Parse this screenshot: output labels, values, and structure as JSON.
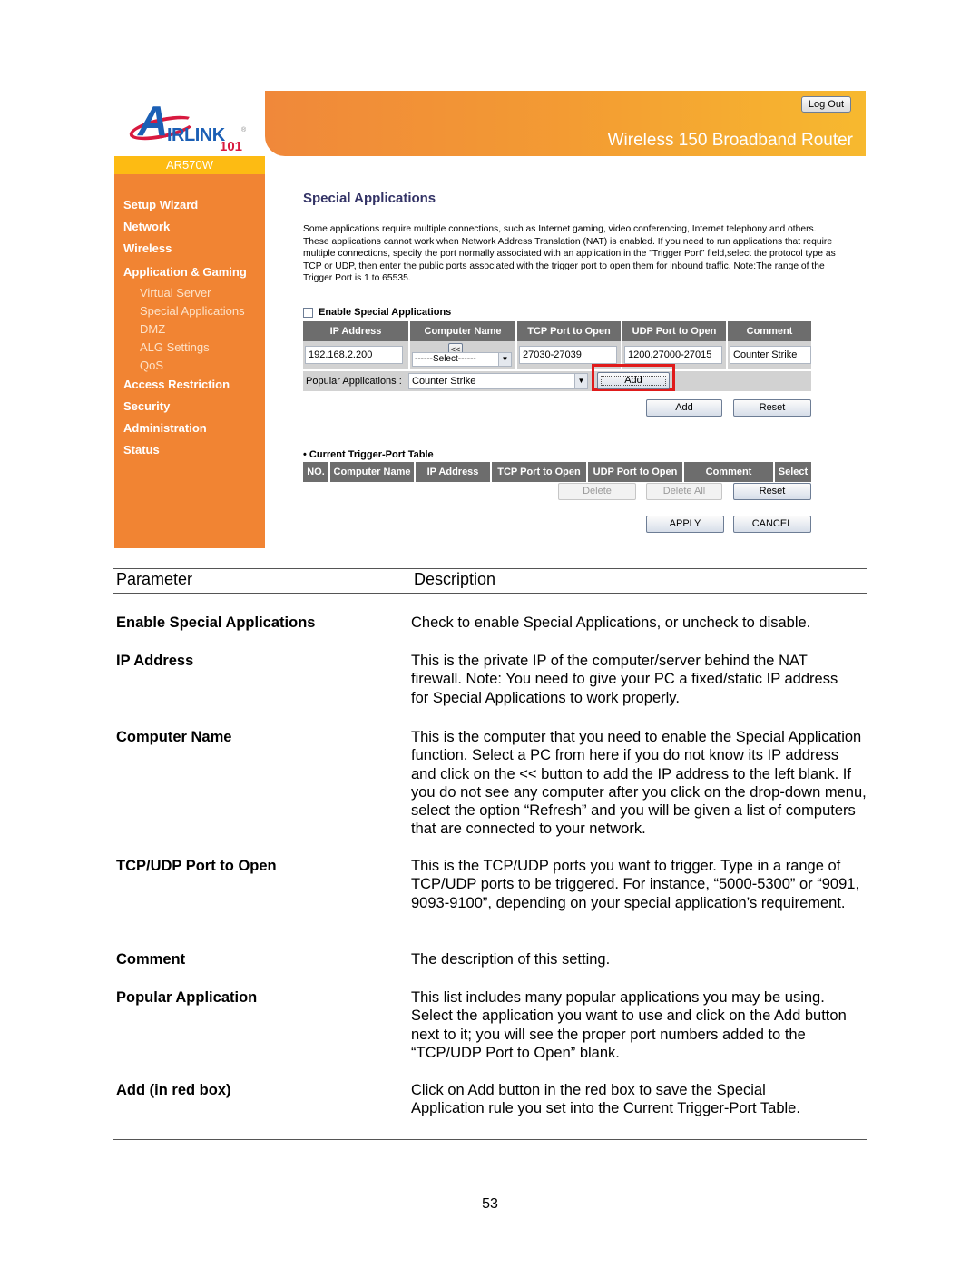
{
  "router_ui": {
    "logo": {
      "brand": "IRLINK",
      "initial": "A",
      "suffix": "101",
      "registered": "®"
    },
    "model": "AR570W",
    "banner_title": "Wireless 150 Broadband Router",
    "logout_label": "Log Out",
    "sidebar": {
      "items": [
        {
          "label": "Setup Wizard",
          "level": "main"
        },
        {
          "label": "Network",
          "level": "main"
        },
        {
          "label": "Wireless",
          "level": "main"
        },
        {
          "label": "Application & Gaming",
          "level": "main"
        },
        {
          "label": "Virtual Server",
          "level": "sub"
        },
        {
          "label": "Special Applications",
          "level": "sub"
        },
        {
          "label": "DMZ",
          "level": "sub"
        },
        {
          "label": "ALG Settings",
          "level": "sub"
        },
        {
          "label": "QoS",
          "level": "sub"
        },
        {
          "label": "Access Restriction",
          "level": "main"
        },
        {
          "label": "Security",
          "level": "main"
        },
        {
          "label": "Administration",
          "level": "main"
        },
        {
          "label": "Status",
          "level": "main"
        }
      ]
    },
    "page_title": "Special Applications",
    "intro": "Some applications require multiple connections, such as Internet gaming, video conferencing, Internet telephony and others. These applications cannot work when Network Address Translation (NAT) is enabled. If you need to run applications that require multiple connections, specify the port normally associated with an application in the \"Trigger Port\" field,select the protocol type as TCP or UDP, then enter the public ports associated with the trigger port to open them for inbound traffic. Note:The range of the Trigger Port is 1 to 65535.",
    "enable_label": "Enable Special Applications",
    "enable_checked": false,
    "form": {
      "headers": [
        "IP Address",
        "Computer Name",
        "TCP Port to Open",
        "UDP Port to Open",
        "Comment"
      ],
      "ip_address": "192.168.2.200",
      "copy_button": "<<",
      "computer_select": "------Select------",
      "tcp_port": "27030-27039",
      "udp_port": "1200,27000-27015",
      "comment": "Counter Strike",
      "popular_label": "Popular Applications :",
      "popular_value": "Counter Strike",
      "popular_add": "Add",
      "add_label": "Add",
      "reset_label": "Reset"
    },
    "trigger_table": {
      "title": "Current Trigger-Port Table",
      "headers": [
        "NO.",
        "Computer Name",
        "IP Address",
        "TCP Port to Open",
        "UDP Port to Open",
        "Comment",
        "Select"
      ],
      "delete_label": "Delete",
      "delete_all_label": "Delete All",
      "reset_label": "Reset"
    },
    "apply_label": "APPLY",
    "cancel_label": "CANCEL"
  },
  "doc_table": {
    "header_param": "Parameter",
    "header_desc": "Description",
    "rows": [
      {
        "param": "Enable Special Applications",
        "desc": "Check to enable Special Applications, or uncheck to disable."
      },
      {
        "param": "IP Address",
        "desc": "This is the private IP of the computer/server behind the NAT firewall. Note: You need to give your PC a fixed/static IP address for Special Applications to work properly."
      },
      {
        "param": "Computer Name",
        "desc": "This is the computer that you need to enable the Special Application function. Select a PC from here if you do not know its IP address and click on the << button to add the IP address to the left blank. If you do not see any computer after you click on the drop-down menu, select the option “Refresh” and you will be given a list of computers that are connected to your network."
      },
      {
        "param": "TCP/UDP Port to Open",
        "desc": "This is the TCP/UDP ports you want to trigger. Type in a range of TCP/UDP ports to be triggered. For instance, “5000-5300” or “9091, 9093-9100”, depending on your special application’s requirement."
      },
      {
        "param": "Comment",
        "desc": "The description of this setting."
      },
      {
        "param": "Popular Application",
        "desc": "This list includes many popular applications you may be using. Select the application you want to use and click on the Add button next to it; you will see the proper port numbers added to the “TCP/UDP Port to Open” blank."
      },
      {
        "param": "Add (in red box)",
        "desc": "Click on Add button in the red box to save the Special Application rule you set into the Current Trigger-Port Table."
      }
    ]
  },
  "page_number": "53"
}
